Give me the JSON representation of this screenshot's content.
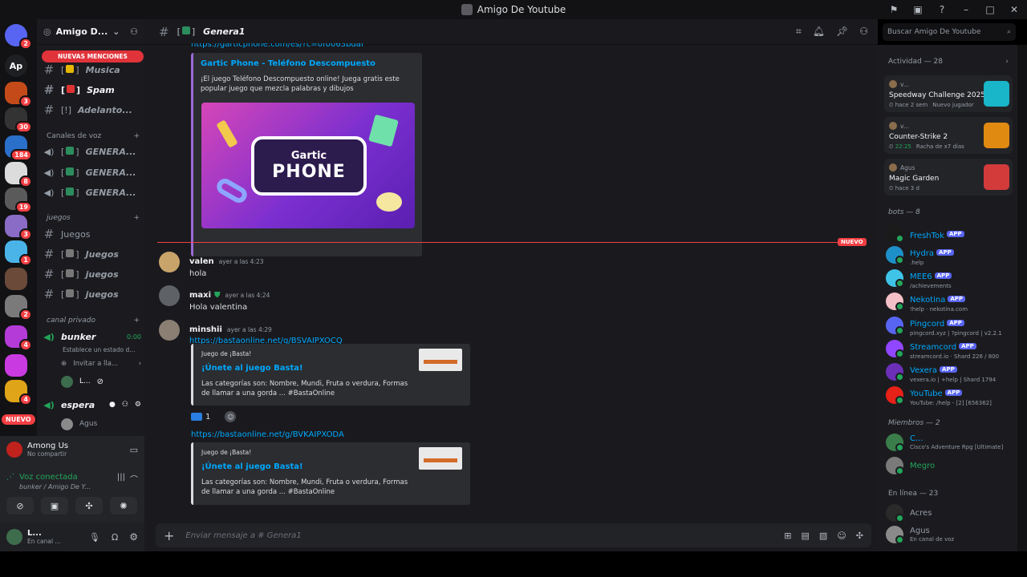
{
  "window": {
    "title": "Amigo De Youtube"
  },
  "rail": {
    "servers": [
      {
        "label": "",
        "badge": "2",
        "color": "#5865f2"
      },
      {
        "label": "Ap",
        "badge": "",
        "color": "#1e1f22"
      },
      {
        "label": "",
        "badge": "3",
        "color": "#c54a1a"
      },
      {
        "label": "",
        "badge": "30",
        "color": "#333"
      },
      {
        "label": "",
        "badge": "184",
        "color": "#2a6fc9"
      },
      {
        "label": "",
        "badge": "8",
        "color": "#dcdcdc"
      },
      {
        "label": "",
        "badge": "19",
        "color": "#5a5a5a"
      },
      {
        "label": "",
        "badge": "3",
        "color": "#8a6cc6"
      },
      {
        "label": "",
        "badge": "1",
        "color": "#4ab3e8"
      },
      {
        "label": "",
        "badge": "",
        "color": "#6b4a3a"
      },
      {
        "label": "",
        "badge": "2",
        "color": "#7a7a7a"
      },
      {
        "label": "",
        "badge": "4",
        "color": "#b43bd8"
      },
      {
        "label": "",
        "badge": "",
        "color": "#c93ae0"
      },
      {
        "label": "",
        "badge": "4",
        "color": "#e0a419"
      }
    ],
    "new_pill": "NUEVO"
  },
  "sidebar": {
    "server_name": "Amigo D...",
    "mentions_pill": "NUEVAS MENCIONES",
    "text_channels": [
      {
        "name": "Musica"
      },
      {
        "name": "Spam"
      },
      {
        "name": "Adelanto..."
      }
    ],
    "voice_category": "Canales de voz",
    "voice_channels": [
      {
        "name": "GENERA..."
      },
      {
        "name": "GENERA..."
      },
      {
        "name": "GENERA..."
      }
    ],
    "games_category": "juegos",
    "games_channels": [
      {
        "name": "Juegos"
      },
      {
        "name": "Juegos"
      },
      {
        "name": "juegos"
      },
      {
        "name": "juegos"
      }
    ],
    "private_category": "canal privado",
    "bunker": {
      "name": "bunker",
      "time": "0:00",
      "status": "Establece un estado d...",
      "invite": "Invitar a lla...",
      "member": "L..."
    },
    "espera": {
      "name": "espera",
      "member": "Agus"
    }
  },
  "voicebox": {
    "activity_name": "Among Us",
    "activity_sub": "No compartir",
    "voice_status": "Voz conectada",
    "voice_channel": "bunker / Amigo De Y...",
    "user_name": "L...",
    "user_status": "En canal ..."
  },
  "chat": {
    "channel_name": "Genera1",
    "partial_link": "https://garticphone.com/es/?c=0f0063bdaf",
    "gartic": {
      "title": "Gartic Phone - Teléfono Descompuesto",
      "desc": "¡El juego Teléfono Descompuesto online! Juega gratis este popular juego que mezcla palabras y dibujos",
      "logo_top": "Gartic",
      "logo_bottom": "PHONE"
    },
    "new_tag": "NUEVO",
    "messages": [
      {
        "user": "valen",
        "time": "ayer a las 4:23",
        "text": "hola",
        "color": "#c9a46a"
      },
      {
        "user": "maxi",
        "time": "ayer a las 4:24",
        "text": "Hola valentina",
        "color": "#5e6166"
      },
      {
        "user": "minshii",
        "time": "ayer a las 4:29",
        "text": "",
        "color": "#8a7f72"
      }
    ],
    "basta1": {
      "link": "https://bastaonline.net/g/BSVAIPXOCQ",
      "provider": "Juego de ¡Basta!",
      "title": "¡Únete al juego Basta!",
      "desc": "Las categorías son: Nombre, Mundi, Fruta o verdura, Formas de llamar a una gorda ... #BastaOnline"
    },
    "reaction_count": "1",
    "basta2": {
      "link": "https://bastaonline.net/g/BVKAIPXODA",
      "provider": "Juego de ¡Basta!",
      "title": "¡Únete al juego Basta!",
      "desc": "Las categorías son: Nombre, Mundi, Fruta o verdura, Formas de llamar a una gorda ... #BastaOnline"
    },
    "composer_placeholder": "Enviar mensaje a #  Genera1"
  },
  "right": {
    "search_placeholder": "Buscar Amigo De Youtube",
    "activity_header": "Actividad — 28",
    "activity_cards": [
      {
        "user": "v...",
        "game": "Speedway Challenge 2025",
        "info1": "hace 2 sem",
        "info2": "Nuevo jugador",
        "thumb": "#19b5c9"
      },
      {
        "user": "v...",
        "game": "Counter-Strike 2",
        "info1": "22:25",
        "info2": "Racha de x7 días",
        "thumb": "#e08a12"
      },
      {
        "user": "Agus",
        "game": "Magic Garden",
        "info1": "hace 3 d",
        "info2": "",
        "thumb": "#d33b3b"
      }
    ],
    "bots_header": "bots — 8",
    "bots": [
      {
        "name": "FreshTok",
        "sub": "",
        "color": "#1a1a1a"
      },
      {
        "name": "Hydra",
        "sub": ".help",
        "color": "#1e90c9"
      },
      {
        "name": "MEE6",
        "sub": "/achievements",
        "color": "#3fc4e8"
      },
      {
        "name": "Nekotina",
        "sub": "!help · nekotina.com",
        "color": "#f4c0c7"
      },
      {
        "name": "Pingcord",
        "sub": "pingcord.xyz | ?pingcord | v2.2.1",
        "color": "#5865f2"
      },
      {
        "name": "Streamcord",
        "sub": "streamcord.io · Shard 226 / 800",
        "color": "#9146ff"
      },
      {
        "name": "Vexera",
        "sub": "vexera.io | +help | Shard 1794",
        "color": "#6b2fb8"
      },
      {
        "name": "YouTube",
        "sub": "YouTube: /help - [2] [656362]",
        "color": "#e62117"
      }
    ],
    "app_tag": "APP",
    "members_header": "Miembros — 2",
    "members": [
      {
        "name": "C...",
        "sub": "Cisco's Adventure Rpg [Ultimate]",
        "color": "#3a7d4a"
      },
      {
        "name": "Megro",
        "sub": "",
        "color": "#7a7a7a"
      }
    ],
    "online_header": "En línea — 23",
    "online": [
      {
        "name": "Acres",
        "sub": "",
        "color": "#2a2a2a"
      },
      {
        "name": "Agus",
        "sub": "En canal de voz",
        "color": "#8a8a8a"
      }
    ]
  }
}
